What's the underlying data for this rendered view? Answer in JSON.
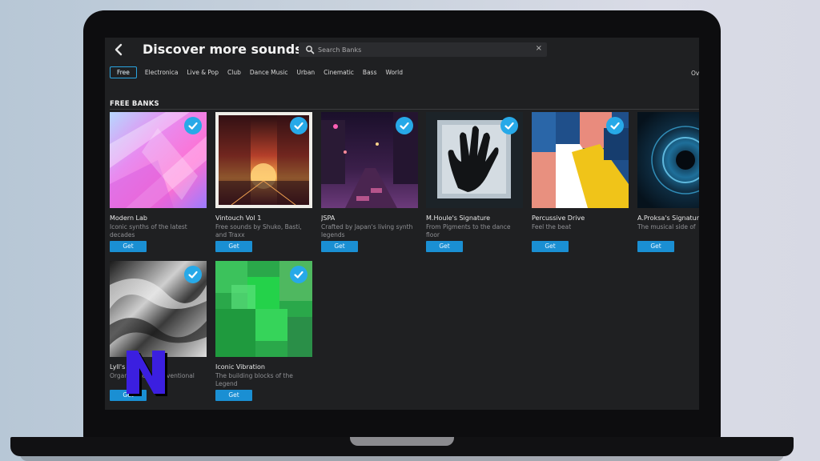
{
  "header": {
    "title": "Discover more sounds",
    "search_placeholder": "Search Banks",
    "clear_icon": "×",
    "back_icon": "‹"
  },
  "filters": [
    "Free",
    "Electronica",
    "Live & Pop",
    "Club",
    "Dance Music",
    "Urban",
    "Cinematic",
    "Bass",
    "World"
  ],
  "filters_active": "Free",
  "overflow_text": "Ov",
  "section": {
    "title": "FREE BANKS"
  },
  "cards": [
    {
      "title": "Modern Lab",
      "desc": "Iconic synths of the latest decades",
      "button": "Get"
    },
    {
      "title": "Vintouch Vol 1",
      "desc": "Free sounds by Shuko, Basti, and Traxx",
      "button": "Get"
    },
    {
      "title": "JSPA",
      "desc": "Crafted by Japan's living synth legends",
      "button": "Get"
    },
    {
      "title": "M.Houle's Signature",
      "desc": "From Pigments to the dance floor",
      "button": "Get"
    },
    {
      "title": "Percussive Drive",
      "desc": "Feel the beat",
      "button": "Get"
    },
    {
      "title": "A.Proksa's Signature",
      "desc": "The musical side of",
      "button": "Get"
    },
    {
      "title": "Lyll's",
      "desc": "Organic and unconventional",
      "button": "Get"
    },
    {
      "title": "Iconic Vibration",
      "desc": "The building blocks of the Legend",
      "button": "Get"
    }
  ],
  "colors": {
    "accent": "#27a9e8",
    "button": "#1a8fd3",
    "panel": "#1f2022",
    "logo": "#3b1fe0"
  }
}
